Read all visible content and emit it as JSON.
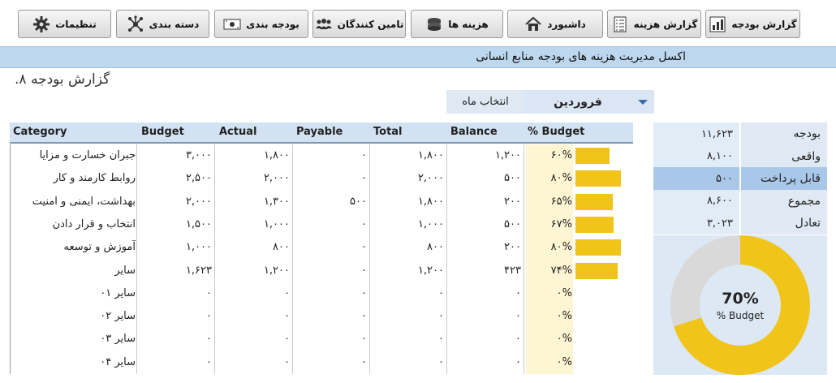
{
  "toolbar": {
    "buttons": [
      {
        "label": "گزارش بودجه",
        "icon": "bar-chart-icon"
      },
      {
        "label": "گزارش هزینه",
        "icon": "checklist-icon"
      },
      {
        "label": "داشبورد",
        "icon": "home-icon"
      },
      {
        "label": "هزینه ها",
        "icon": "coins-icon"
      },
      {
        "label": "تامین کنندگان",
        "icon": "people-icon"
      },
      {
        "label": "بودجه بندی",
        "icon": "money-icon"
      },
      {
        "label": "دسته بندی",
        "icon": "network-icon"
      },
      {
        "label": "تنظیمات",
        "icon": "gear-icon"
      }
    ]
  },
  "banner": {
    "title": "اکسل مدیریت هزینه های بودجه منابع انسانی"
  },
  "report": {
    "title": "گزارش بودجه ۸."
  },
  "month": {
    "label": "انتخاب ماه",
    "value": "فروردین"
  },
  "table": {
    "headers": {
      "category": "Category",
      "budget": "Budget",
      "actual": "Actual",
      "payable": "Payable",
      "total": "Total",
      "balance": "Balance",
      "pct": "% Budget"
    },
    "rows": [
      {
        "category": "جبران خسارت و مزایا",
        "budget": "۳,۰۰۰",
        "actual": "۱,۸۰۰",
        "payable": "۰",
        "total": "۱,۸۰۰",
        "balance": "۱,۲۰۰",
        "pct": "۶۰%",
        "pct_value": 60
      },
      {
        "category": "روابط کارمند و کار",
        "budget": "۲,۵۰۰",
        "actual": "۲,۰۰۰",
        "payable": "۰",
        "total": "۲,۰۰۰",
        "balance": "۵۰۰",
        "pct": "۸۰%",
        "pct_value": 80
      },
      {
        "category": "بهداشت، ایمنی و امنیت",
        "budget": "۲,۰۰۰",
        "actual": "۱,۳۰۰",
        "payable": "۵۰۰",
        "total": "۱,۸۰۰",
        "balance": "۲۰۰",
        "pct": "۶۵%",
        "pct_value": 65
      },
      {
        "category": "انتخاب و قرار دادن",
        "budget": "۱,۵۰۰",
        "actual": "۱,۰۰۰",
        "payable": "۰",
        "total": "۱,۰۰۰",
        "balance": "۵۰۰",
        "pct": "۶۷%",
        "pct_value": 67
      },
      {
        "category": "آموزش و توسعه",
        "budget": "۱,۰۰۰",
        "actual": "۸۰۰",
        "payable": "۰",
        "total": "۸۰۰",
        "balance": "۲۰۰",
        "pct": "۸۰%",
        "pct_value": 80
      },
      {
        "category": "سایر",
        "budget": "۱,۶۲۳",
        "actual": "۱,۲۰۰",
        "payable": "۰",
        "total": "۱,۲۰۰",
        "balance": "۴۲۳",
        "pct": "۷۴%",
        "pct_value": 74
      },
      {
        "category": "سایر ۰۱",
        "budget": "۰",
        "actual": "۰",
        "payable": "۰",
        "total": "۰",
        "balance": "۰",
        "pct": "۰%",
        "pct_value": 0
      },
      {
        "category": "سایر ۰۲",
        "budget": "۰",
        "actual": "۰",
        "payable": "۰",
        "total": "۰",
        "balance": "۰",
        "pct": "۰%",
        "pct_value": 0
      },
      {
        "category": "سایر ۰۳",
        "budget": "۰",
        "actual": "۰",
        "payable": "۰",
        "total": "۰",
        "balance": "۰",
        "pct": "۰%",
        "pct_value": 0
      },
      {
        "category": "سایر ۰۴",
        "budget": "۰",
        "actual": "۰",
        "payable": "۰",
        "total": "۰",
        "balance": "۰",
        "pct": "۰%",
        "pct_value": 0
      }
    ]
  },
  "summary": {
    "rows": [
      {
        "label": "بودجه",
        "value": "۱۱,۶۲۳"
      },
      {
        "label": "واقعی",
        "value": "۸,۱۰۰"
      },
      {
        "label": "قابل پرداخت",
        "value": "۵۰۰"
      },
      {
        "label": "مجموع",
        "value": "۸,۶۰۰"
      },
      {
        "label": "تعادل",
        "value": "۳,۰۲۳"
      }
    ],
    "donut": {
      "percent_text": "70%",
      "label": "% Budget",
      "fraction": 0.7
    }
  },
  "colors": {
    "accent": "#f0c419",
    "remaining": "#d9d9d9",
    "banner": "#bcd7ee",
    "highlight": "#a9c7e8"
  }
}
